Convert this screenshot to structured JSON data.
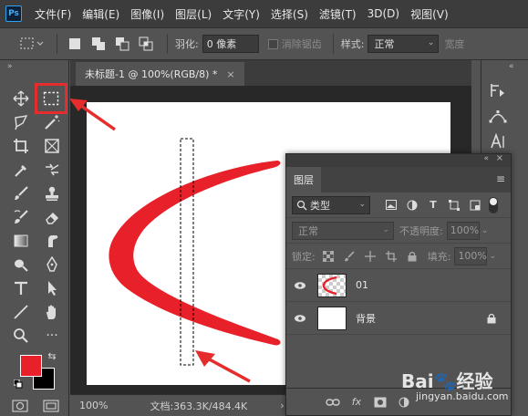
{
  "app": {
    "logo": "Ps"
  },
  "menu": [
    "文件(F)",
    "编辑(E)",
    "图像(I)",
    "图层(L)",
    "文字(Y)",
    "选择(S)",
    "滤镜(T)",
    "3D(D)",
    "视图(V)"
  ],
  "options": {
    "feather_label": "羽化:",
    "feather_value": "0 像素",
    "antialias_label": "消除锯齿",
    "style_label": "样式:",
    "style_value": "正常",
    "width_label": "宽度"
  },
  "document": {
    "tab_title": "未标题-1 @ 100%(RGB/8) *",
    "close_glyph": "×",
    "zoom": "100%",
    "doc_info": "文档:363.3K/484.4K"
  },
  "colors": {
    "foreground": "#e8202a",
    "background": "#000000",
    "shape": "#e8202a",
    "highlight": "#e52d2d"
  },
  "layers_panel": {
    "title": "图层",
    "filter_value": "类型",
    "blend_mode": "正常",
    "opacity_label": "不透明度:",
    "opacity_value": "100%",
    "lock_label": "锁定:",
    "fill_label": "填充:",
    "fill_value": "100%",
    "layers": [
      {
        "name": "01",
        "thumb": "checker-shape",
        "visible": true,
        "locked": false
      },
      {
        "name": "背景",
        "thumb": "white",
        "visible": true,
        "locked": true
      }
    ],
    "footer_icons": [
      "link-icon",
      "fx-icon",
      "mask-icon",
      "adjustment-icon",
      "group-icon",
      "new-layer-icon",
      "trash-icon"
    ],
    "fx_label": "fx"
  },
  "watermark": {
    "brand": "Bai🐾经验",
    "url": "jingyan.baidu.com"
  }
}
